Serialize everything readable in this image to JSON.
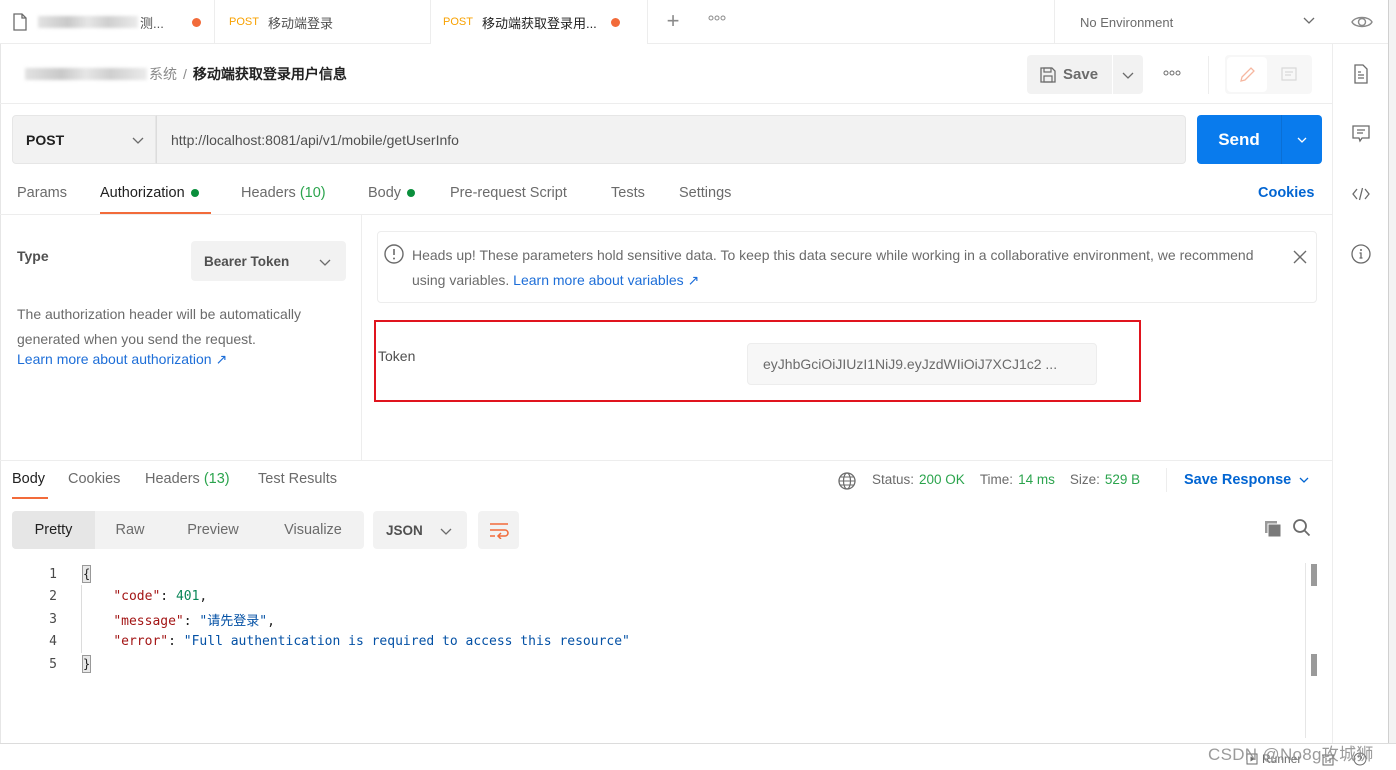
{
  "tabs": [
    {
      "icon": "document-icon",
      "label": "测...",
      "blurred_prefix": true,
      "unsaved": true
    },
    {
      "method": "POST",
      "label": "移动端登录",
      "unsaved": false
    },
    {
      "method": "POST",
      "label": "移动端获取登录用...",
      "unsaved": true,
      "active": true
    }
  ],
  "tabbar": {
    "new_tab": "+",
    "more": "ooo"
  },
  "environment": {
    "selected": "No Environment"
  },
  "breadcrumb": {
    "parent_suffix": "系统",
    "separator": "/",
    "current": "移动端获取登录用户信息"
  },
  "toolbar": {
    "save_label": "Save",
    "more": "ooo"
  },
  "request": {
    "method": "POST",
    "url": "http://localhost:8081/api/v1/mobile/getUserInfo",
    "send_label": "Send"
  },
  "request_tabs": [
    {
      "label": "Params"
    },
    {
      "label": "Authorization",
      "dot": true,
      "active": true
    },
    {
      "label": "Headers",
      "count": "(10)"
    },
    {
      "label": "Body",
      "dot": true
    },
    {
      "label": "Pre-request Script"
    },
    {
      "label": "Tests"
    },
    {
      "label": "Settings"
    }
  ],
  "cookies_label": "Cookies",
  "auth": {
    "type_label": "Type",
    "type_value": "Bearer Token",
    "description": "The authorization header will be automatically generated when you send the request.",
    "learn_more": "Learn more about authorization ↗",
    "warning_text": "Heads up! These parameters hold sensitive data. To keep this data secure while working in a collaborative environment, we recommend using variables.",
    "warning_link": "Learn more about variables ↗",
    "token_label": "Token",
    "token_value": "eyJhbGciOiJIUzI1NiJ9.eyJzdWIiOiJ7XCJ1c2 ..."
  },
  "response": {
    "tabs": [
      {
        "label": "Body",
        "active": true
      },
      {
        "label": "Cookies"
      },
      {
        "label": "Headers",
        "count": "(13)"
      },
      {
        "label": "Test Results"
      }
    ],
    "status_label": "Status:",
    "status_value": "200 OK",
    "time_label": "Time:",
    "time_value": "14 ms",
    "size_label": "Size:",
    "size_value": "529 B",
    "save_response": "Save Response",
    "view_modes": [
      "Pretty",
      "Raw",
      "Preview",
      "Visualize"
    ],
    "active_view": "Pretty",
    "format": "JSON",
    "code_lines": [
      {
        "n": "1",
        "text": "{"
      },
      {
        "n": "2",
        "key": "\"code\"",
        "value": "401",
        "vtype": "num",
        "trail": ","
      },
      {
        "n": "3",
        "key": "\"message\"",
        "value": "\"请先登录\"",
        "vtype": "str",
        "trail": ","
      },
      {
        "n": "4",
        "key": "\"error\"",
        "value": "\"Full authentication is required to access this resource\"",
        "vtype": "str",
        "trail": ""
      },
      {
        "n": "5",
        "text": "}"
      }
    ]
  },
  "footer": {
    "runner": "Runner",
    "watermark": "CSDN @No8g攻城狮"
  },
  "colors": {
    "accent": "#f26b3a",
    "send": "#097bed",
    "link": "#0265d2",
    "success": "#2ba44d",
    "highlight_box": "#e0141e"
  }
}
